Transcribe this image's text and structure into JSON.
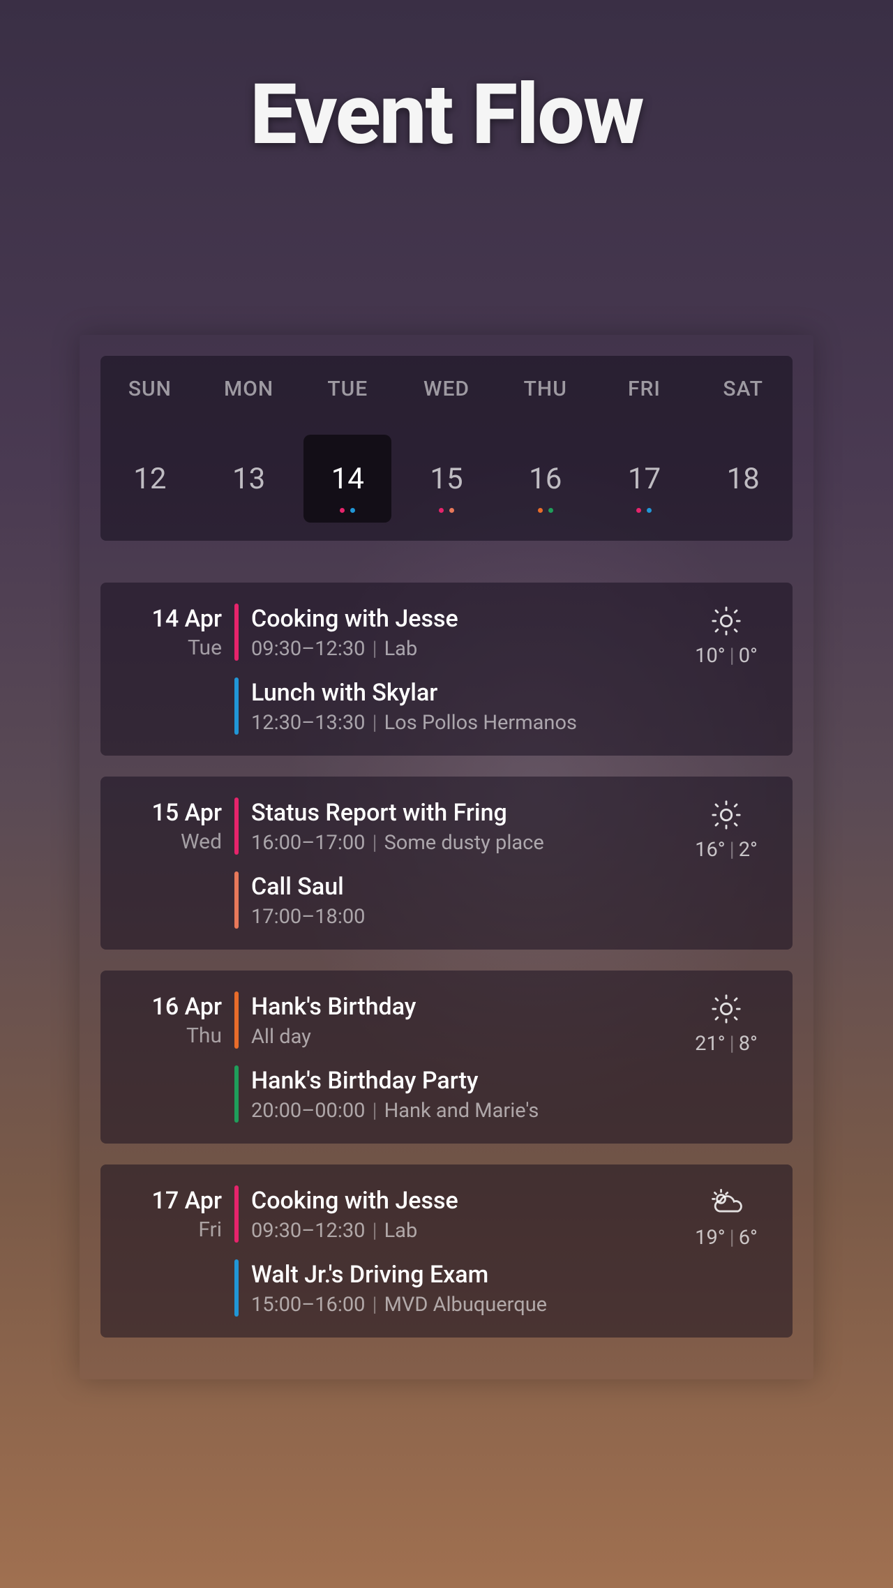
{
  "title": "Event Flow",
  "colors": {
    "pink": "#e6246b",
    "blue": "#2196d6",
    "coral": "#e8795a",
    "orange": "#e86c2a",
    "green": "#1f9e5a"
  },
  "week": {
    "days": [
      {
        "name": "SUN",
        "num": "12",
        "selected": false,
        "dots": []
      },
      {
        "name": "MON",
        "num": "13",
        "selected": false,
        "dots": []
      },
      {
        "name": "TUE",
        "num": "14",
        "selected": true,
        "dots": [
          "pink",
          "blue"
        ]
      },
      {
        "name": "WED",
        "num": "15",
        "selected": false,
        "dots": [
          "pink",
          "coral"
        ]
      },
      {
        "name": "THU",
        "num": "16",
        "selected": false,
        "dots": [
          "orange",
          "green"
        ]
      },
      {
        "name": "FRI",
        "num": "17",
        "selected": false,
        "dots": [
          "pink",
          "blue"
        ]
      },
      {
        "name": "SAT",
        "num": "18",
        "selected": false,
        "dots": []
      }
    ]
  },
  "days": [
    {
      "date": "14 Apr",
      "dow": "Tue",
      "weather": {
        "icon": "sun",
        "hi": "10°",
        "lo": "0°"
      },
      "events": [
        {
          "color": "pink",
          "title": "Cooking with Jesse",
          "time": "09:30–12:30",
          "location": "Lab"
        },
        {
          "color": "blue",
          "title": "Lunch with Skylar",
          "time": "12:30–13:30",
          "location": "Los Pollos Hermanos"
        }
      ]
    },
    {
      "date": "15 Apr",
      "dow": "Wed",
      "weather": {
        "icon": "sun",
        "hi": "16°",
        "lo": "2°"
      },
      "events": [
        {
          "color": "pink",
          "title": "Status Report with Fring",
          "time": "16:00–17:00",
          "location": "Some dusty place"
        },
        {
          "color": "coral",
          "title": "Call Saul",
          "time": "17:00–18:00",
          "location": ""
        }
      ]
    },
    {
      "date": "16 Apr",
      "dow": "Thu",
      "weather": {
        "icon": "sun",
        "hi": "21°",
        "lo": "8°"
      },
      "events": [
        {
          "color": "orange",
          "title": "Hank's Birthday",
          "time": "All day",
          "location": ""
        },
        {
          "color": "green",
          "title": "Hank's Birthday Party",
          "time": "20:00–00:00",
          "location": "Hank and Marie's"
        }
      ]
    },
    {
      "date": "17 Apr",
      "dow": "Fri",
      "weather": {
        "icon": "partly-cloudy",
        "hi": "19°",
        "lo": "6°"
      },
      "events": [
        {
          "color": "pink",
          "title": "Cooking with Jesse",
          "time": "09:30–12:30",
          "location": "Lab"
        },
        {
          "color": "blue",
          "title": "Walt Jr.'s Driving Exam",
          "time": "15:00–16:00",
          "location": "MVD Albuquerque"
        }
      ]
    }
  ]
}
